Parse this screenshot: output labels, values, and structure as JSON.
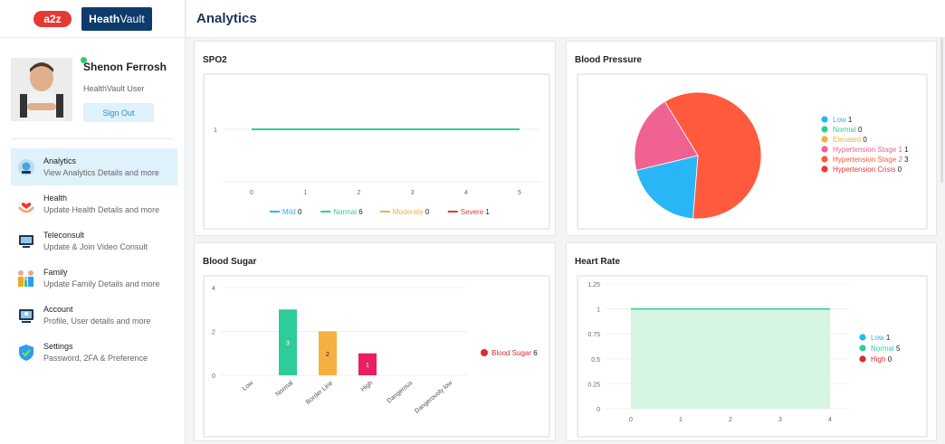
{
  "header": {
    "logo_a2z": "a2z",
    "logo_brand_a": "Heath",
    "logo_brand_b": "Vault",
    "title": "Analytics"
  },
  "profile": {
    "name": "Shenon Ferrosh",
    "role": "HealthVault User",
    "sign_out": "Sign Out"
  },
  "sidebar": {
    "items": [
      {
        "title": "Analytics",
        "subtitle": "View Analytics Details and more",
        "icon": "analytics-icon",
        "active": true
      },
      {
        "title": "Health",
        "subtitle": "Update Health Details and more",
        "icon": "heart-hand-icon"
      },
      {
        "title": "Teleconsult",
        "subtitle": "Update & Join Video Consult",
        "icon": "monitor-icon"
      },
      {
        "title": "Family",
        "subtitle": "Update Family Details and more",
        "icon": "family-icon"
      },
      {
        "title": "Account",
        "subtitle": "Profile, User details and more",
        "icon": "account-icon"
      },
      {
        "title": "Settings",
        "subtitle": "Password, 2FA & Preference",
        "icon": "shield-check-icon"
      }
    ]
  },
  "cards": {
    "spo2": "SPO2",
    "bp": "Blood Pressure",
    "sugar": "Blood Sugar",
    "hr": "Heart Rate"
  },
  "chart_data": [
    {
      "id": "spo2",
      "type": "line",
      "title": "SPO2",
      "x": [
        0,
        1,
        2,
        3,
        4,
        5
      ],
      "ylim": [
        0,
        1
      ],
      "y_ticks": [
        "1"
      ],
      "x_ticks": [
        "0",
        "1",
        "2",
        "3",
        "4",
        "5"
      ],
      "series": [
        {
          "name": "Normal",
          "values": [
            1,
            1,
            1,
            1,
            1,
            1
          ],
          "color": "#2ecc9a"
        }
      ],
      "legend": [
        {
          "name": "Mild",
          "count": "0",
          "color": "#29b6f6"
        },
        {
          "name": "Normal",
          "count": "6",
          "color": "#2ecc9a"
        },
        {
          "name": "Moderate",
          "count": "0",
          "color": "#f5b041"
        },
        {
          "name": "Severe",
          "count": "1",
          "color": "#e53935"
        }
      ],
      "legend_position": "bottom"
    },
    {
      "id": "bp",
      "type": "pie",
      "title": "Blood Pressure",
      "slices": [
        {
          "name": "Low",
          "value": 1,
          "color": "#29b6f6"
        },
        {
          "name": "Normal",
          "value": 0,
          "color": "#2ecc9a"
        },
        {
          "name": "Elevated",
          "value": 0,
          "color": "#f5b041"
        },
        {
          "name": "Hypertension Stage 1",
          "value": 1,
          "color": "#f06292"
        },
        {
          "name": "Hypertension Stage 2",
          "value": 3,
          "color": "#ff5a3d"
        },
        {
          "name": "Hypertension Crisis",
          "value": 0,
          "color": "#e53935"
        }
      ],
      "legend_position": "right"
    },
    {
      "id": "sugar",
      "type": "bar",
      "title": "Blood Sugar",
      "categories": [
        "Low",
        "Normal",
        "Border Line",
        "High",
        "Dangerous",
        "Dangerously low"
      ],
      "values": [
        0,
        3,
        2,
        1,
        0,
        0
      ],
      "colors": [
        "#29b6f6",
        "#2ecc9a",
        "#f5b041",
        "#e91e63",
        "#e53935",
        "#9c27b0"
      ],
      "ylim": [
        0,
        4
      ],
      "y_ticks": [
        "0",
        "2",
        "4"
      ],
      "legend": [
        {
          "name": "Blood Sugar",
          "count": "6",
          "color": "#d32f2f"
        }
      ],
      "legend_position": "right"
    },
    {
      "id": "hr",
      "type": "area",
      "title": "Heart Rate",
      "x": [
        0,
        1,
        2,
        3,
        4
      ],
      "ylim": [
        0,
        1.25
      ],
      "y_ticks": [
        "0",
        "0.25",
        "0.5",
        "0.75",
        "1",
        "1.25"
      ],
      "x_ticks": [
        "0",
        "1",
        "2",
        "3",
        "4"
      ],
      "area_x_range": [
        0,
        4
      ],
      "series": [
        {
          "name": "Normal",
          "values": [
            1,
            1,
            1,
            1,
            1
          ],
          "color": "#2ecc9a"
        }
      ],
      "legend": [
        {
          "name": "Low",
          "count": "1",
          "color": "#29b6f6"
        },
        {
          "name": "Normal",
          "count": "5",
          "color": "#2ecc9a"
        },
        {
          "name": "High",
          "count": "0",
          "color": "#d32f2f"
        }
      ],
      "legend_position": "right"
    }
  ]
}
